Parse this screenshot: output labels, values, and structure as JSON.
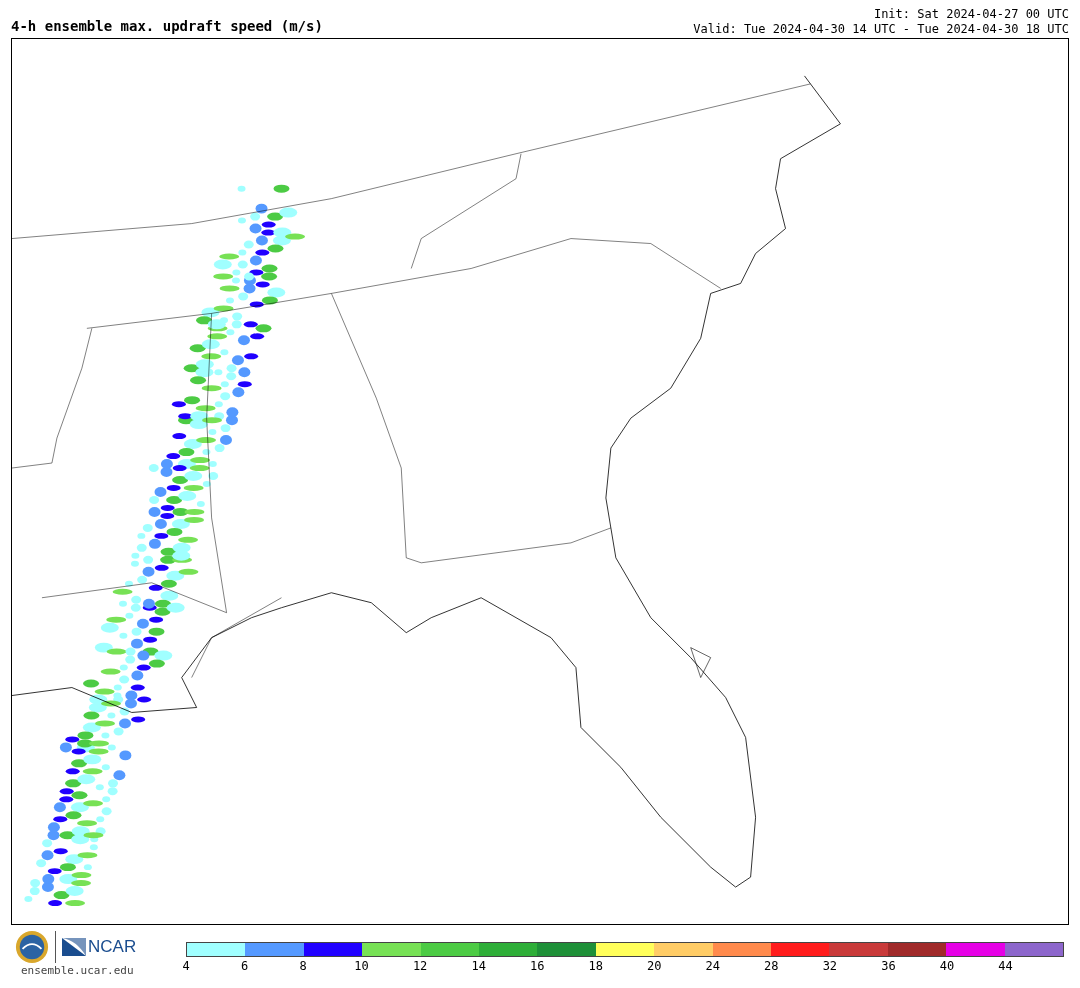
{
  "title": "4-h ensemble max. updraft speed (m/s)",
  "init": "Init: Sat 2024-04-27 00 UTC",
  "valid": "Valid: Tue 2024-04-30 14 UTC - Tue 2024-04-30 18 UTC",
  "footer": {
    "logo_text": "NCAR",
    "url": "ensemble.ucar.edu"
  },
  "colorbar": {
    "segments": [
      {
        "color": "#a0ffff"
      },
      {
        "color": "#5599ff"
      },
      {
        "color": "#2000ff"
      },
      {
        "color": "#77e155"
      },
      {
        "color": "#4ccb44"
      },
      {
        "color": "#2eae38"
      },
      {
        "color": "#1e9038"
      },
      {
        "color": "#ffff5a"
      },
      {
        "color": "#ffcc66"
      },
      {
        "color": "#ff8a4c"
      },
      {
        "color": "#ff1c1c"
      },
      {
        "color": "#c93a3a"
      },
      {
        "color": "#a02a2a"
      },
      {
        "color": "#e600e6"
      },
      {
        "color": "#8d66cc"
      }
    ],
    "ticks": [
      "4",
      "6",
      "8",
      "10",
      "12",
      "14",
      "16",
      "18",
      "20",
      "24",
      "28",
      "32",
      "36",
      "40",
      "44"
    ]
  }
}
